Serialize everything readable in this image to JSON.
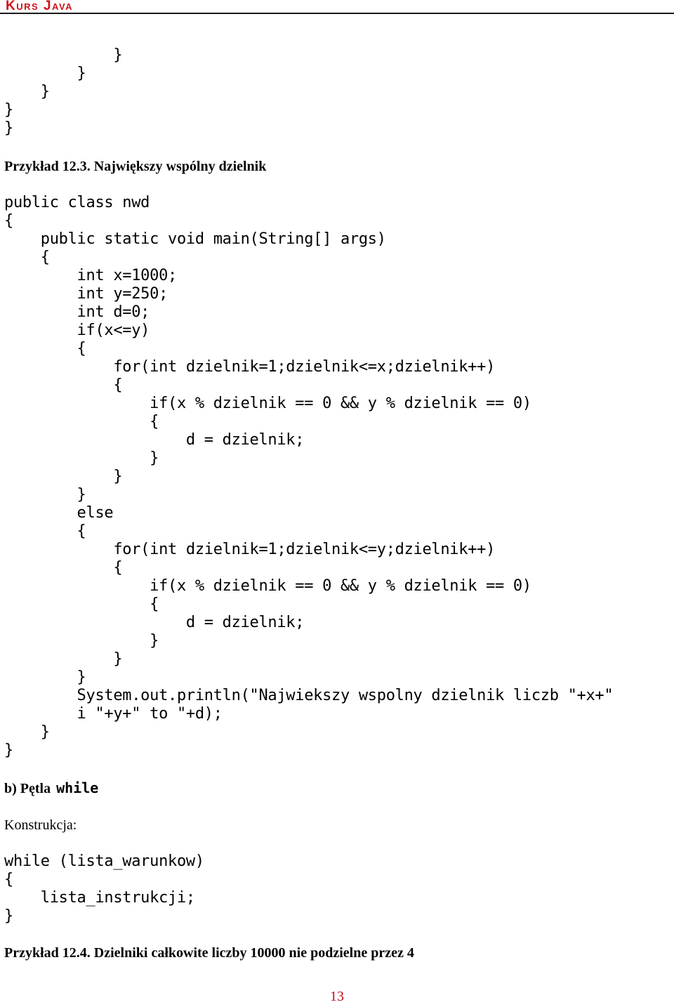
{
  "header": {
    "title": "Kurs Java"
  },
  "code_top": [
    "            }",
    "        }",
    "    }",
    "}",
    "}"
  ],
  "example_12_3": {
    "heading": "Przykład 12.3. Największy wspólny dzielnik",
    "code": [
      "public class nwd",
      "{",
      "    public static void main(String[] args)",
      "    {",
      "        int x=1000;",
      "        int y=250;",
      "        int d=0;",
      "        if(x<=y)",
      "        {",
      "            for(int dzielnik=1;dzielnik<=x;dzielnik++)",
      "            {",
      "                if(x % dzielnik == 0 && y % dzielnik == 0)",
      "                {",
      "                    d = dzielnik;",
      "                }",
      "            }",
      "        }",
      "        else",
      "        {",
      "            for(int dzielnik=1;dzielnik<=y;dzielnik++)",
      "            {",
      "                if(x % dzielnik == 0 && y % dzielnik == 0)",
      "                {",
      "                    d = dzielnik;",
      "                }",
      "            }",
      "        }",
      "        System.out.println(\"Najwiekszy wspolny dzielnik liczb \"+x+\"",
      "        i \"+y+\" to \"+d);",
      "    }",
      "}"
    ]
  },
  "section_b": {
    "heading_prefix": "b) Pętla",
    "heading_keyword": "while",
    "construction_label": "Konstrukcja:",
    "code": [
      "while (lista_warunkow)",
      "{",
      "    lista_instrukcji;",
      "}"
    ]
  },
  "example_12_4": {
    "heading": "Przykład 12.4. Dzielniki całkowite liczby 10000 nie podzielne przez 4"
  },
  "footer": {
    "page_number": "13"
  }
}
